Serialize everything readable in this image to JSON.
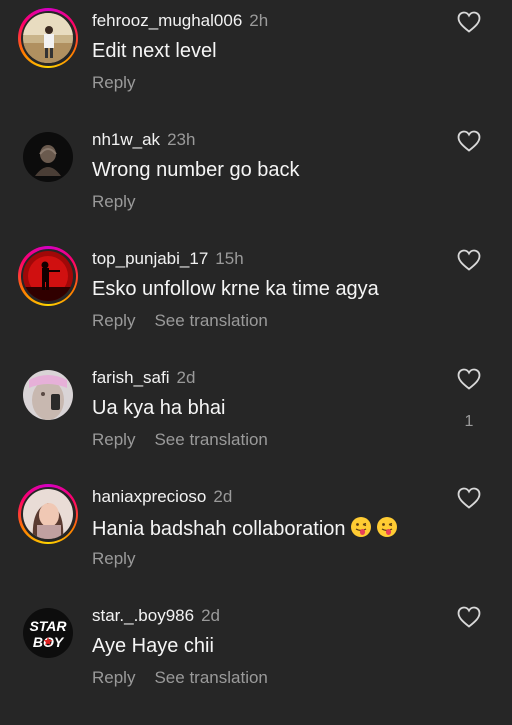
{
  "comments": [
    {
      "username": "fehrooz_mughal006",
      "time": "2h",
      "text": "Edit next level",
      "reply": "Reply",
      "translation": "",
      "likes": "",
      "ring": true
    },
    {
      "username": "nh1w_ak",
      "time": "23h",
      "text": "Wrong number go back",
      "reply": "Reply",
      "translation": "",
      "likes": "",
      "ring": false
    },
    {
      "username": "top_punjabi_17",
      "time": "15h",
      "text": "Esko unfollow krne ka time agya",
      "reply": "Reply",
      "translation": "See translation",
      "likes": "",
      "ring": true
    },
    {
      "username": "farish_safi",
      "time": "2d",
      "text": "Ua kya ha bhai",
      "reply": "Reply",
      "translation": "See translation",
      "likes": "1",
      "ring": false
    },
    {
      "username": "haniaxprecioso",
      "time": "2d",
      "text": "Hania badshah collaboration",
      "reply": "Reply",
      "translation": "",
      "likes": "",
      "ring": true,
      "emoji": [
        "winking-tongue-emoji",
        "winking-tongue-emoji"
      ]
    },
    {
      "username": "star._.boy986",
      "time": "2d",
      "text": "Aye Haye chii",
      "reply": "Reply",
      "translation": "See translation",
      "likes": "",
      "ring": false,
      "avatar_text": "STAR BOY"
    }
  ],
  "colors": {
    "background": "#262626",
    "secondary_text": "#9a9a9a",
    "ring_gradient": [
      "#d300c5",
      "#ff0069",
      "#ff7a00",
      "#ffd600"
    ]
  },
  "icons": {
    "like": "heart-outline-icon"
  }
}
